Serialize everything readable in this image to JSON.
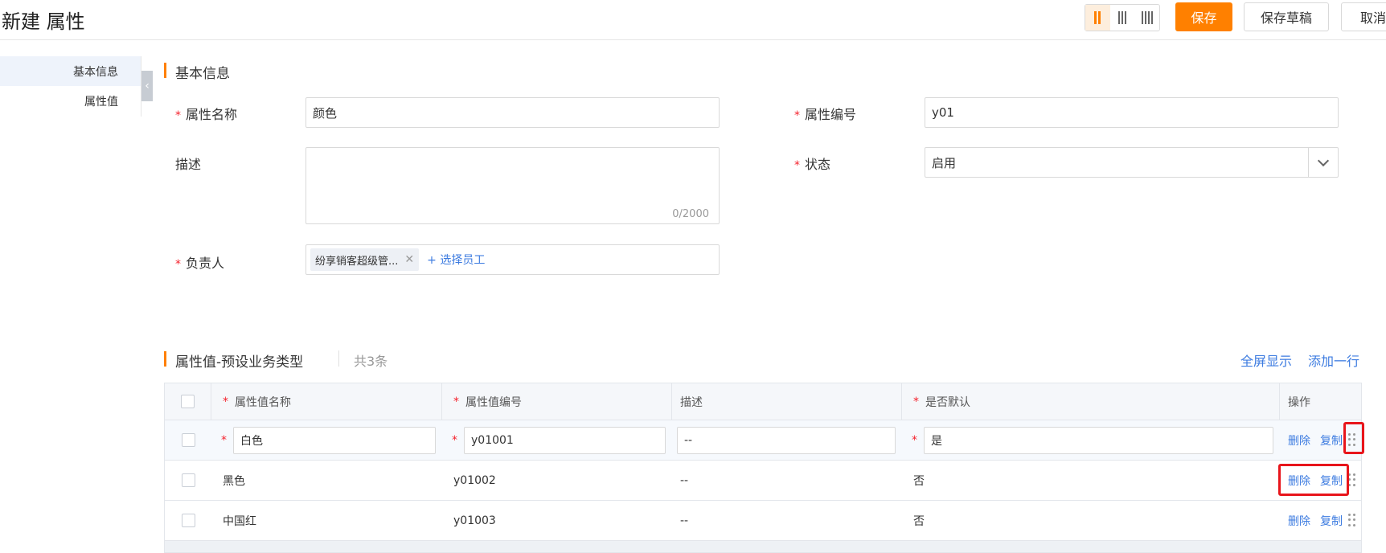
{
  "header": {
    "title": "新建 属性",
    "save_label": "保存",
    "save_draft_label": "保存草稿",
    "cancel_label": "取消"
  },
  "sidenav": {
    "items": [
      {
        "label": "基本信息",
        "active": true
      },
      {
        "label": "属性值",
        "active": false
      }
    ]
  },
  "basic": {
    "section_title": "基本信息",
    "name_label": "属性名称",
    "name_value": "颜色",
    "code_label": "属性编号",
    "code_value": "y01",
    "desc_label": "描述",
    "desc_counter": "0/2000",
    "status_label": "状态",
    "status_value": "启用",
    "owner_label": "负责人",
    "owner_tag": "纷享销客超级管...",
    "add_employee": "+ 选择员工"
  },
  "values": {
    "section_title": "属性值-预设业务类型",
    "count": "共3条",
    "fullscreen": "全屏显示",
    "add_row": "添加一行",
    "columns": {
      "name": "属性值名称",
      "code": "属性值编号",
      "desc": "描述",
      "default": "是否默认",
      "ops": "操作"
    },
    "rows": [
      {
        "name": "白色",
        "code": "y01001",
        "desc": "--",
        "default": "是",
        "editing": true
      },
      {
        "name": "黑色",
        "code": "y01002",
        "desc": "--",
        "default": "否",
        "editing": false
      },
      {
        "name": "中国红",
        "code": "y01003",
        "desc": "--",
        "default": "否",
        "editing": false
      }
    ],
    "delete_label": "删除",
    "copy_label": "复制"
  },
  "colors": {
    "accent": "#ff8000",
    "link": "#3c7be0",
    "required": "#f5222d",
    "highlight": "#e8151b"
  }
}
